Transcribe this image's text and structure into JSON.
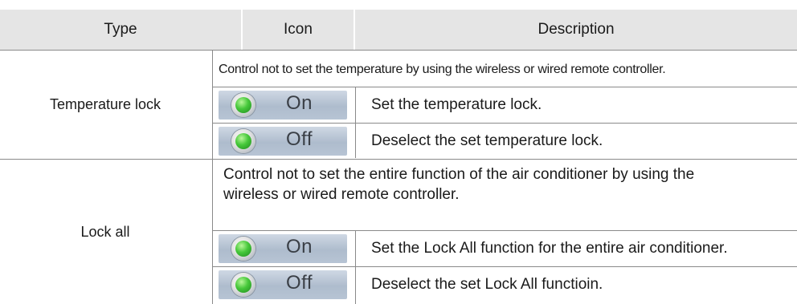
{
  "header": {
    "type_label": "Type",
    "icon_label": "Icon",
    "description_label": "Description"
  },
  "sections": [
    {
      "type": "Temperature lock",
      "summary": "Control not to set the temperature by using the wireless or wired remote controller.",
      "rows": [
        {
          "icon": "green-indicator-icon",
          "state": "On",
          "description": "Set the temperature lock."
        },
        {
          "icon": "green-indicator-icon",
          "state": "Off",
          "description": "Deselect the set temperature lock."
        }
      ]
    },
    {
      "type": "Lock all",
      "summary_line1": "Control not to set the entire function of the air conditioner by using the",
      "summary_line2": "wireless or wired remote controller.",
      "rows": [
        {
          "icon": "green-indicator-icon",
          "state": "On",
          "description": "Set the Lock All function for the entire air conditioner."
        },
        {
          "icon": "green-indicator-icon",
          "state": "Off",
          "description": "Deselect the set Lock All functioin."
        }
      ]
    }
  ]
}
